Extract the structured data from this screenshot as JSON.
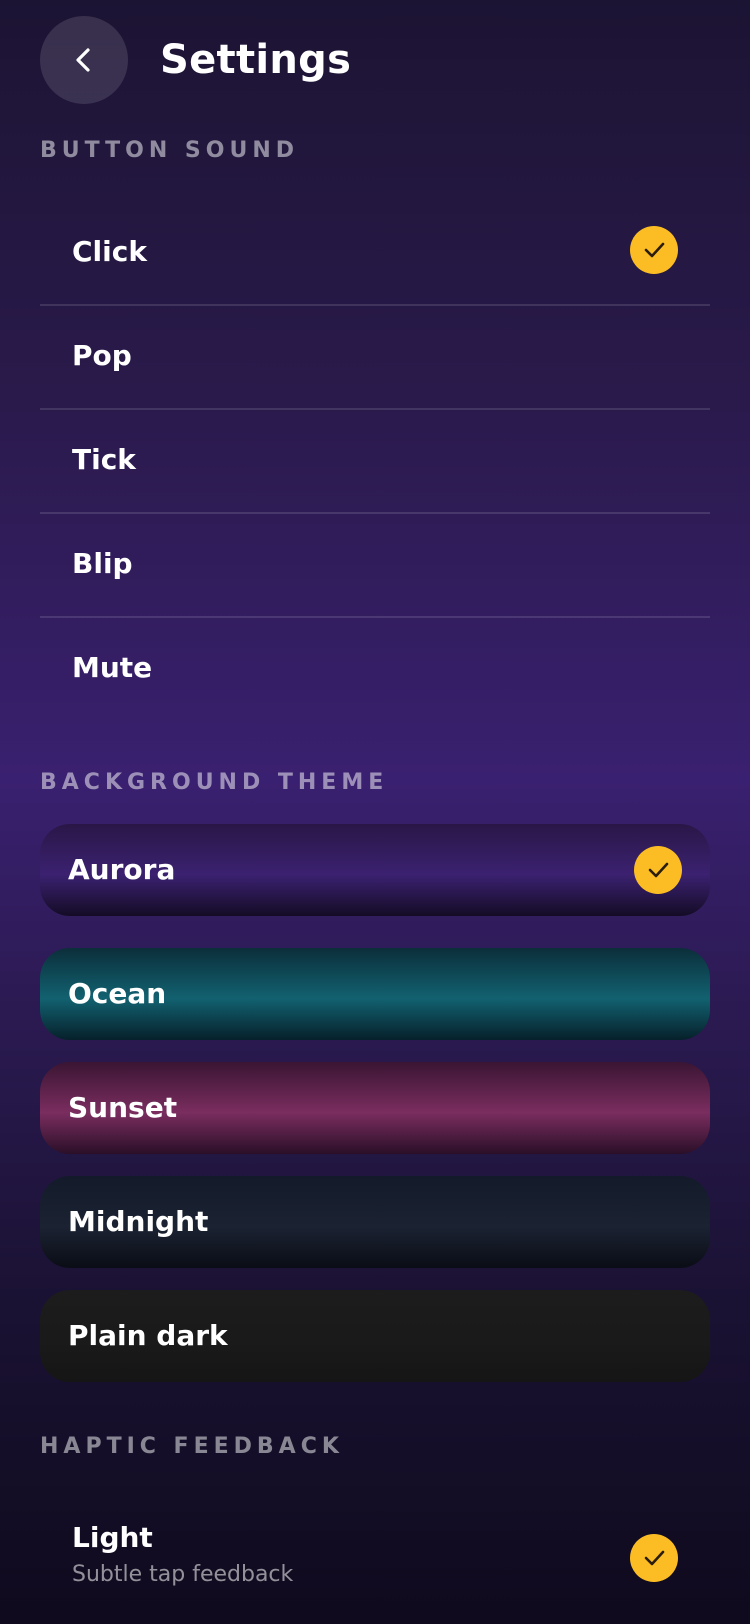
{
  "header": {
    "title": "Settings",
    "back_icon": "chevron-left-icon"
  },
  "button_sound": {
    "label": "BUTTON SOUND",
    "options": [
      {
        "label": "Click",
        "selected": true
      },
      {
        "label": "Pop",
        "selected": false
      },
      {
        "label": "Tick",
        "selected": false
      },
      {
        "label": "Blip",
        "selected": false
      },
      {
        "label": "Mute",
        "selected": false
      }
    ]
  },
  "background_theme": {
    "label": "BACKGROUND THEME",
    "options": [
      {
        "label": "Aurora",
        "selected": true,
        "colors": [
          "#2a1747",
          "#3b2170",
          "#140c26"
        ]
      },
      {
        "label": "Ocean",
        "selected": false,
        "colors": [
          "#0b2e3a",
          "#126170",
          "#06202a"
        ]
      },
      {
        "label": "Sunset",
        "selected": false,
        "colors": [
          "#3a1533",
          "#7a2d5f",
          "#2a0f28"
        ]
      },
      {
        "label": "Midnight",
        "selected": false,
        "colors": [
          "#131a2a",
          "#1b2232",
          "#0a0d15"
        ]
      },
      {
        "label": "Plain dark",
        "selected": false,
        "colors": [
          "#1c1c1c",
          "#1a1a1a",
          "#151515"
        ]
      }
    ]
  },
  "haptic_feedback": {
    "label": "HAPTIC FEEDBACK",
    "options": [
      {
        "label": "Light",
        "sublabel": "Subtle tap feedback",
        "selected": true
      }
    ]
  },
  "accent_color": "#fbbd23"
}
